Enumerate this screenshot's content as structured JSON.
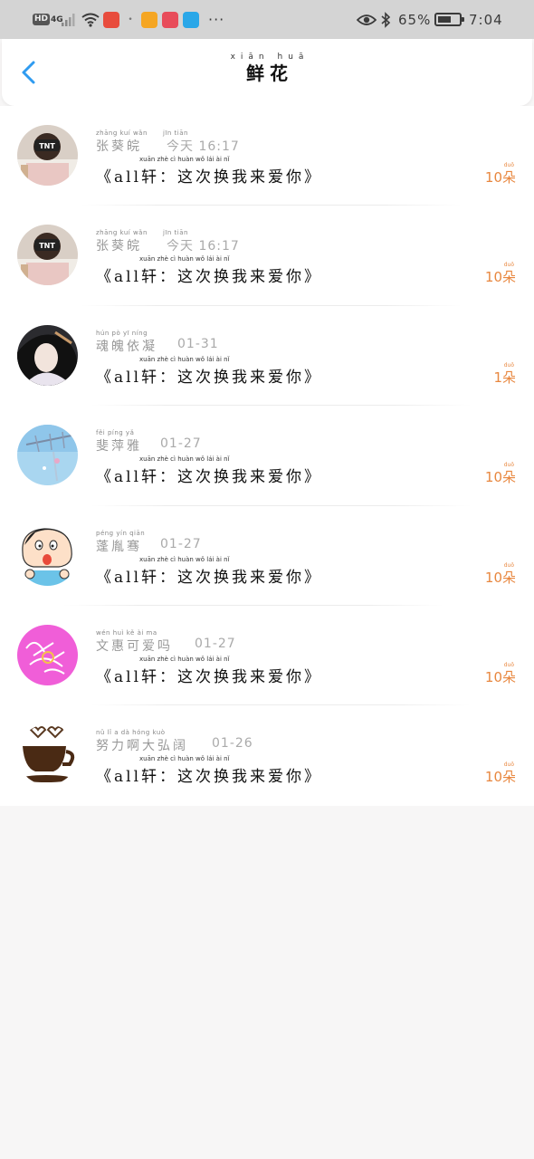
{
  "status_bar": {
    "hd": "HD",
    "network": "4G",
    "dots": "···",
    "battery_percent": "65%",
    "battery_level": 0.65,
    "time": "7:04",
    "app_icon_colors": [
      "#e84c3d",
      "#f5a623",
      "#e84c5a",
      "#2aa7e8"
    ]
  },
  "header": {
    "back_icon": "chevron-left-icon",
    "title_pinyin": "xiān huā",
    "title": "鲜花",
    "accent_color": "#2f9bf0"
  },
  "list": {
    "count_color": "#e8873f",
    "items": [
      {
        "name_pinyin": "zhāng kuí wǎn",
        "name": "张葵皖",
        "time_pinyin": "jīn tiān",
        "time": "今天 16:17",
        "message_pinyin": "xuān        zhè  cì  huàn  wǒ  lái  ài  nǐ",
        "message": "《all轩：这次换我来爱你》",
        "count_pinyin": "duǒ",
        "count": "10朵",
        "avatar": "tnt-avatar"
      },
      {
        "name_pinyin": "zhāng kuí wǎn",
        "name": "张葵皖",
        "time_pinyin": "jīn tiān",
        "time": "今天 16:17",
        "message_pinyin": "xuān        zhè  cì  huàn  wǒ  lái  ài  nǐ",
        "message": "《all轩：这次换我来爱你》",
        "count_pinyin": "duǒ",
        "count": "10朵",
        "avatar": "tnt-avatar"
      },
      {
        "name_pinyin": "hún pò yī níng",
        "name": "魂魄依凝",
        "time_pinyin": "",
        "time": "01-31",
        "message_pinyin": "xuān        zhè  cì  huàn  wǒ  lái  ài  nǐ",
        "message": "《all轩：这次换我来爱你》",
        "count_pinyin": "duǒ",
        "count": "1朵",
        "avatar": "girl-avatar"
      },
      {
        "name_pinyin": "fěi píng yǎ",
        "name": "斐萍雅",
        "time_pinyin": "",
        "time": "01-27",
        "message_pinyin": "xuān        zhè  cì  huàn  wǒ  lái  ài  nǐ",
        "message": "《all轩：这次换我来爱你》",
        "count_pinyin": "duǒ",
        "count": "10朵",
        "avatar": "sky-avatar"
      },
      {
        "name_pinyin": "péng yín qiān",
        "name": "蓬胤骞",
        "time_pinyin": "",
        "time": "01-27",
        "message_pinyin": "xuān        zhè  cì  huàn  wǒ  lái  ài  nǐ",
        "message": "《all轩：这次换我来爱你》",
        "count_pinyin": "duǒ",
        "count": "10朵",
        "avatar": "cartoon-avatar"
      },
      {
        "name_pinyin": "wén huì kě ài ma",
        "name": "文惠可爱吗",
        "time_pinyin": "",
        "time": "01-27",
        "message_pinyin": "xuān        zhè  cì  huàn  wǒ  lái  ài  nǐ",
        "message": "《all轩：这次换我来爱你》",
        "count_pinyin": "duǒ",
        "count": "10朵",
        "avatar": "pink-avatar"
      },
      {
        "name_pinyin": "nǔ lǐ a dà hóng kuò",
        "name": "努力啊大弘阔",
        "time_pinyin": "",
        "time": "01-26",
        "message_pinyin": "xuān        zhè  cì  huàn  wǒ  lái  ài  nǐ",
        "message": "《all轩：这次换我来爱你》",
        "count_pinyin": "duǒ",
        "count": "10朵",
        "avatar": "coffee-avatar"
      }
    ]
  }
}
